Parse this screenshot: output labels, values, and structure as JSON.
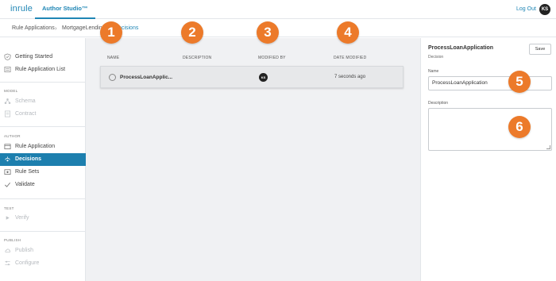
{
  "header": {
    "logo": "inrule",
    "app_tab": "Author Studio™",
    "logout": "Log Out",
    "user_initials": "KS"
  },
  "breadcrumb": {
    "items": [
      "Rule Applications",
      "MortgageLending",
      "Decisions"
    ]
  },
  "sidebar": {
    "top_items": [
      {
        "label": "Getting Started",
        "icon": "shield-check-icon"
      },
      {
        "label": "Rule Application List",
        "icon": "list-icon"
      }
    ],
    "sections": [
      {
        "heading": "MODEL",
        "items": [
          {
            "label": "Schema",
            "icon": "schema-icon",
            "disabled": true
          },
          {
            "label": "Contract",
            "icon": "contract-icon",
            "disabled": true
          }
        ]
      },
      {
        "heading": "AUTHOR",
        "items": [
          {
            "label": "Rule Application",
            "icon": "rule-app-icon",
            "disabled": false
          },
          {
            "label": "Decisions",
            "icon": "decision-icon",
            "disabled": false,
            "selected": true
          },
          {
            "label": "Rule Sets",
            "icon": "rule-sets-icon",
            "disabled": false
          },
          {
            "label": "Validate",
            "icon": "check-icon",
            "disabled": false
          }
        ]
      },
      {
        "heading": "TEST",
        "items": [
          {
            "label": "Verify",
            "icon": "play-icon",
            "disabled": true
          }
        ]
      },
      {
        "heading": "PUBLISH",
        "items": [
          {
            "label": "Publish",
            "icon": "cloud-icon",
            "disabled": true
          },
          {
            "label": "Configure",
            "icon": "configure-icon",
            "disabled": true
          }
        ]
      }
    ]
  },
  "table": {
    "columns": [
      "NAME",
      "DESCRIPTION",
      "MODIFIED BY",
      "DATE MODIFIED"
    ],
    "rows": [
      {
        "name": "ProcessLoanApplic...",
        "description": "",
        "modified_by": "KS",
        "date_modified": "7 seconds ago"
      }
    ]
  },
  "panel": {
    "title": "ProcessLoanApplication",
    "subtitle": "Decision",
    "save_label": "Save",
    "name_label": "Name",
    "name_value": "ProcessLoanApplication",
    "description_label": "Description",
    "description_value": ""
  },
  "callouts": [
    "1",
    "2",
    "3",
    "4",
    "5",
    "6"
  ],
  "colors": {
    "accent": "#1f86b5",
    "selected_bg": "#1d7fae",
    "callout": "#ec7a2a"
  }
}
